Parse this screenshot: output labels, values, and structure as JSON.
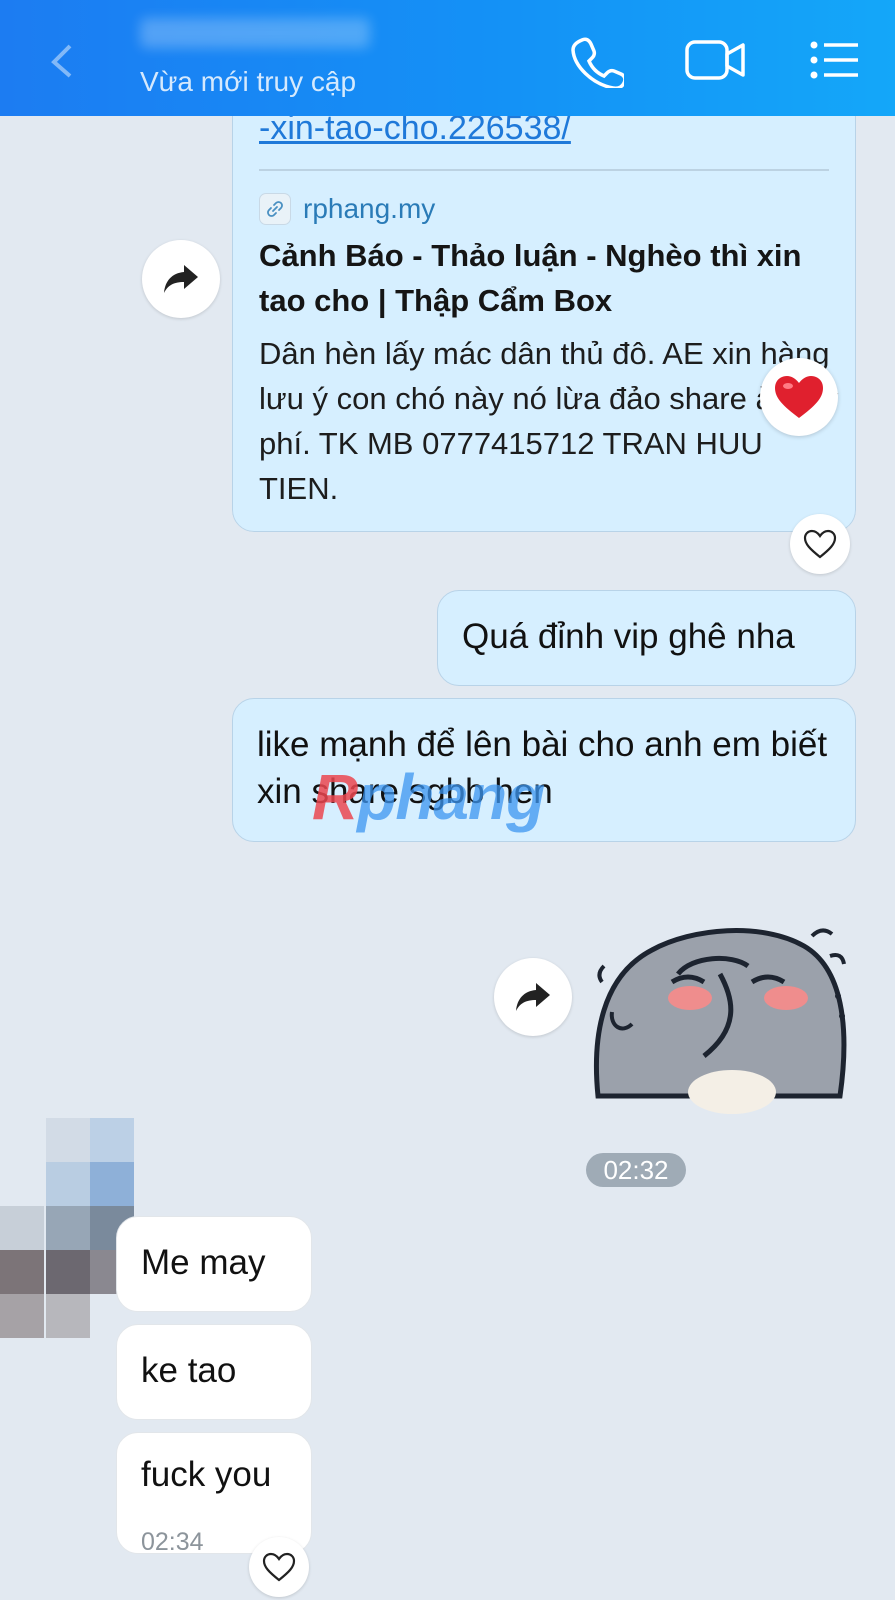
{
  "header": {
    "status": "Vừa mới truy cập",
    "icons": [
      "phone-icon",
      "video-call-icon",
      "menu-list-icon"
    ]
  },
  "messages": {
    "link_card": {
      "url_fragment": "-xin-tao-cho.226538/",
      "domain": "rphang.my",
      "title": "Cảnh Báo - Thảo luận - Nghèo thì xin tao cho | Thập Cẩm Box",
      "description": "Dân hèn lấy mác dân thủ đô. AE xin hàng lưu ý con chó này nó lừa đảo share ảo lấy phí. TK MB 0777415712 TRAN HUU TIEN."
    },
    "out_1": "Quá đỉnh vip ghê nha",
    "out_2": "like mạnh để lên bài cho anh em biết xin share sgbb hen",
    "time_divider": "02:32",
    "in_1": "Me may",
    "in_2": "ke tao",
    "in_3": "fuck you",
    "in_3_time": "02:34"
  },
  "watermark": {
    "first_letter": "R",
    "rest": "phang"
  },
  "colors": {
    "header_start": "#1c7cf2",
    "header_end": "#14a7f9",
    "outgoing_bubble": "#d6efff",
    "incoming_bubble": "#ffffff",
    "background": "#e2e9f1",
    "reaction_heart": "#e0202e"
  }
}
